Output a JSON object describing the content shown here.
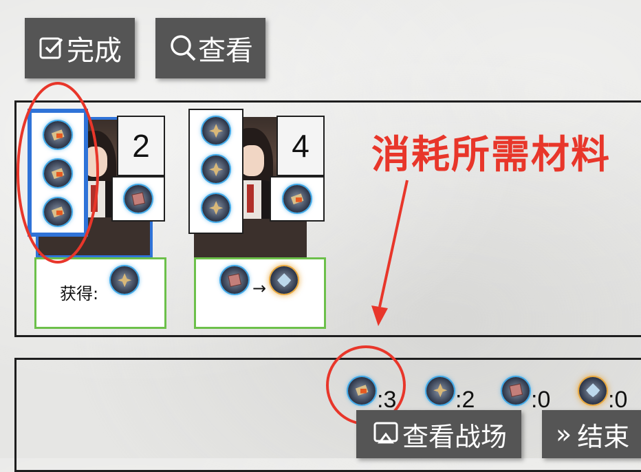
{
  "toolbar": {
    "done_label": "完成",
    "view_label": "查看"
  },
  "cards": [
    {
      "cost_number": "2",
      "cost_items": [
        "fire-material",
        "fire-material",
        "fire-material"
      ],
      "side_item": "copper-material",
      "gain_label": "获得:",
      "gain_item": "gold-material"
    },
    {
      "cost_number": "4",
      "cost_items": [
        "gold-material",
        "gold-material",
        "gold-material"
      ],
      "side_item": "fire-material",
      "convert_from": "copper-material",
      "convert_arrow": "→",
      "convert_to": "silver-crystal"
    }
  ],
  "annotation": {
    "text": "消耗所需材料",
    "color": "#e8362a"
  },
  "inventory": [
    {
      "icon": "fire-material",
      "count": ":3"
    },
    {
      "icon": "gold-material",
      "count": ":2"
    },
    {
      "icon": "copper-material",
      "count": ":0"
    },
    {
      "icon": "silver-crystal",
      "count": ":0"
    }
  ],
  "bottom_buttons": {
    "view_field_label": "查看战场",
    "end_label": "结束",
    "end_glyph": "»"
  },
  "colors": {
    "button_bg": "#555555",
    "selected_border": "#2f73d8",
    "reward_border": "#6cc04a",
    "highlight_red": "#e8362a"
  }
}
